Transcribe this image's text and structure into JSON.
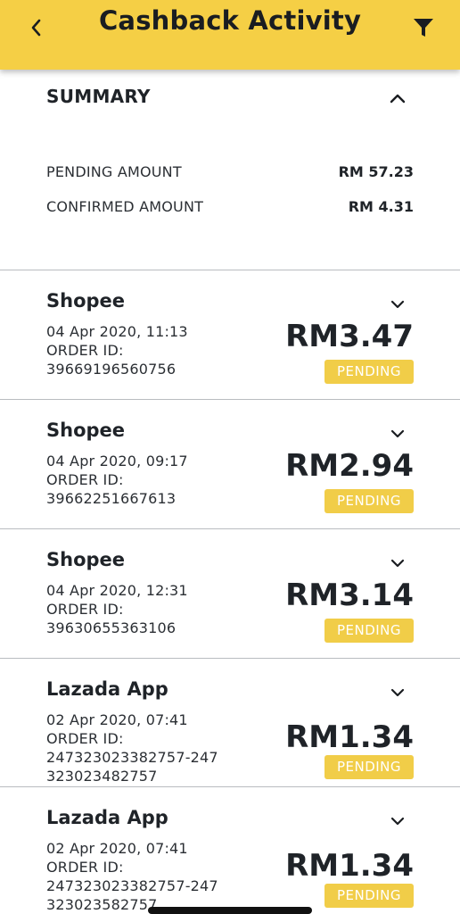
{
  "header": {
    "title": "Cashback Activity",
    "background": "#f5cf45"
  },
  "summary": {
    "title": "SUMMARY",
    "pending_label": "PENDING AMOUNT",
    "pending_value": "RM 57.23",
    "confirmed_label": "CONFIRMED AMOUNT",
    "confirmed_value": "RM 4.31"
  },
  "transactions": [
    {
      "merchant": "Shopee",
      "date": "04 Apr 2020, 11:13",
      "order_label": "ORDER ID:",
      "order_id": "39669196560756",
      "order_id_cont": "",
      "amount": "RM3.47",
      "status": "PENDING"
    },
    {
      "merchant": "Shopee",
      "date": "04 Apr 2020, 09:17",
      "order_label": "ORDER ID:",
      "order_id": "39662251667613",
      "order_id_cont": "",
      "amount": "RM2.94",
      "status": "PENDING"
    },
    {
      "merchant": "Shopee",
      "date": "04 Apr 2020, 12:31",
      "order_label": "ORDER ID:",
      "order_id": "39630655363106",
      "order_id_cont": "",
      "amount": "RM3.14",
      "status": "PENDING"
    },
    {
      "merchant": "Lazada App",
      "date": "02 Apr 2020, 07:41",
      "order_label": "ORDER ID:",
      "order_id": "247323023382757-247",
      "order_id_cont": "323023482757",
      "amount": "RM1.34",
      "status": "PENDING"
    },
    {
      "merchant": "Lazada App",
      "date": "02 Apr 2020, 07:41",
      "order_label": "ORDER ID:",
      "order_id": "247323023382757-247",
      "order_id_cont": "323023582757",
      "amount": "RM1.34",
      "status": "PENDING"
    }
  ],
  "colors": {
    "accent": "#f5cf45",
    "badge": "#f1cd48",
    "text": "#1f2328",
    "divider": "#b9bcc0"
  },
  "icons": {
    "back": "chevron-left-icon",
    "filter": "filter-funnel-icon",
    "collapse": "chevron-up-icon",
    "expand": "chevron-down-icon"
  }
}
